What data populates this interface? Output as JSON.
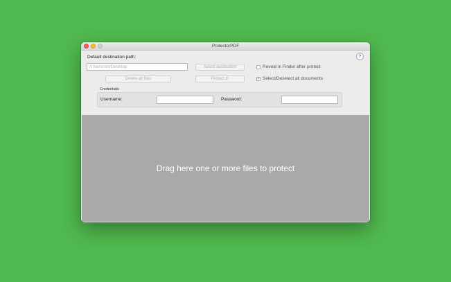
{
  "window": {
    "title": "ProtectorPDF",
    "help_label": "?"
  },
  "destination": {
    "label": "Default destination path:",
    "path_placeholder": "/Users/sid/Desktop",
    "select_button": "Select destination"
  },
  "actions": {
    "delete_button": "Delete all files",
    "protect_button": "Protect it!"
  },
  "options": {
    "reveal_label": "Reveal in Finder after protect",
    "reveal_checked": false,
    "select_all_label": "Select/Deselect all documents",
    "select_all_checked": true,
    "check_mark": "✓"
  },
  "credentials": {
    "group_label": "Credentials",
    "username_label": "Username:",
    "username_value": "",
    "password_label": "Password:",
    "password_value": ""
  },
  "dropzone": {
    "text": "Drag here one or more files to protect"
  },
  "colors": {
    "desktop": "#50b94f",
    "dropzone": "#a9a9a9",
    "close": "#fc5f57",
    "minimize": "#fdbb2e"
  }
}
